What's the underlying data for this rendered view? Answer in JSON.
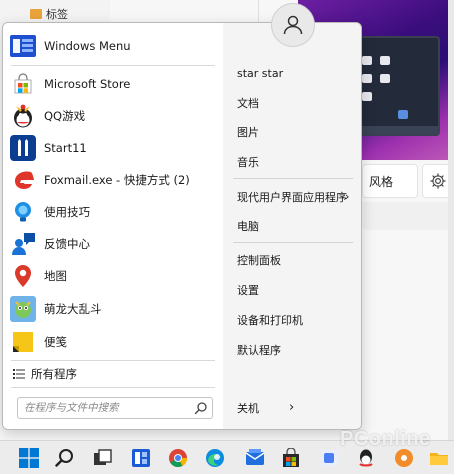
{
  "background": {
    "folder_label": "标签",
    "style_label": "风格",
    "watermark": "PConline"
  },
  "start_menu": {
    "apps": [
      {
        "label": "Windows Menu",
        "icon": "windows-menu-icon"
      },
      {
        "label": "Microsoft Store",
        "icon": "microsoft-store-icon"
      },
      {
        "label": "QQ游戏",
        "icon": "qq-games-icon"
      },
      {
        "label": "Start11",
        "icon": "start11-icon"
      },
      {
        "label": "Foxmail.exe - 快捷方式 (2)",
        "icon": "foxmail-icon"
      },
      {
        "label": "使用技巧",
        "icon": "tips-icon"
      },
      {
        "label": "反馈中心",
        "icon": "feedback-hub-icon"
      },
      {
        "label": "地图",
        "icon": "maps-icon"
      },
      {
        "label": "萌龙大乱斗",
        "icon": "dragon-game-icon"
      },
      {
        "label": "便笺",
        "icon": "sticky-notes-icon"
      }
    ],
    "all_programs": "所有程序",
    "search_placeholder": "在程序与文件中搜索",
    "right": {
      "user": "star star",
      "documents": "文档",
      "pictures": "图片",
      "music": "音乐",
      "modern_apps": "现代用户界面应用程序",
      "computer": "电脑",
      "control_panel": "控制面板",
      "settings": "设置",
      "devices_printers": "设备和打印机",
      "default_programs": "默认程序",
      "shutdown": "关机"
    }
  },
  "colors": {
    "accent": "#0067c0",
    "menu_bg": "#f4f4f4",
    "left_pane_bg": "#ffffff"
  }
}
